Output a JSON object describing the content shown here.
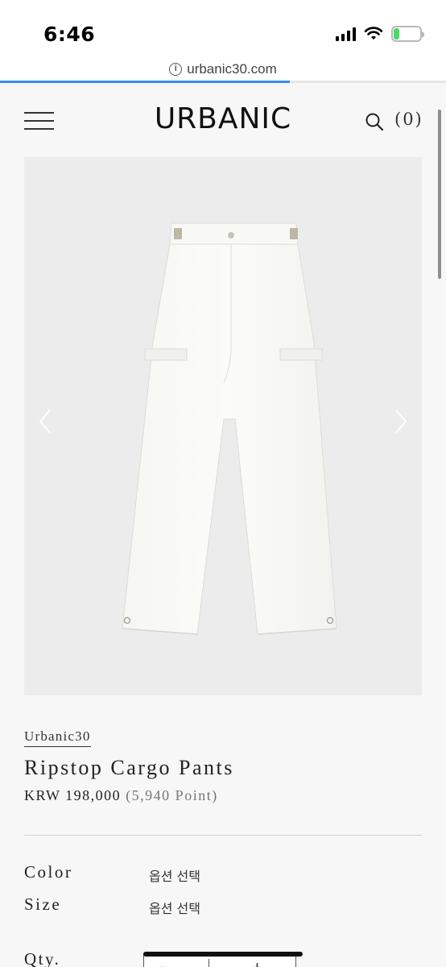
{
  "status_bar": {
    "time": "6:46",
    "battery_level": "21"
  },
  "browser": {
    "url": "urbanic30.com",
    "load_progress": 0.65
  },
  "header": {
    "logo": "URBANIC",
    "cart_count": "(0)"
  },
  "product": {
    "brand": "Urbanic30",
    "title": "Ripstop Cargo Pants",
    "price": "KRW 198,000",
    "points": "(5,940 Point)"
  },
  "options": {
    "color_label": "Color",
    "color_value": "옵션 선택",
    "size_label": "Size",
    "size_value": "옵션 선택",
    "qty_label": "Qty.",
    "qty_minus": "−",
    "qty_plus": "+"
  },
  "colors": {
    "accent": "#3a8ee8",
    "background": "#f7f7f7",
    "image_bg": "#ececec"
  },
  "icons": [
    "info-icon",
    "menu-icon",
    "search-icon",
    "chevron-left-icon",
    "chevron-right-icon",
    "signal-icon",
    "wifi-icon",
    "battery-icon"
  ]
}
